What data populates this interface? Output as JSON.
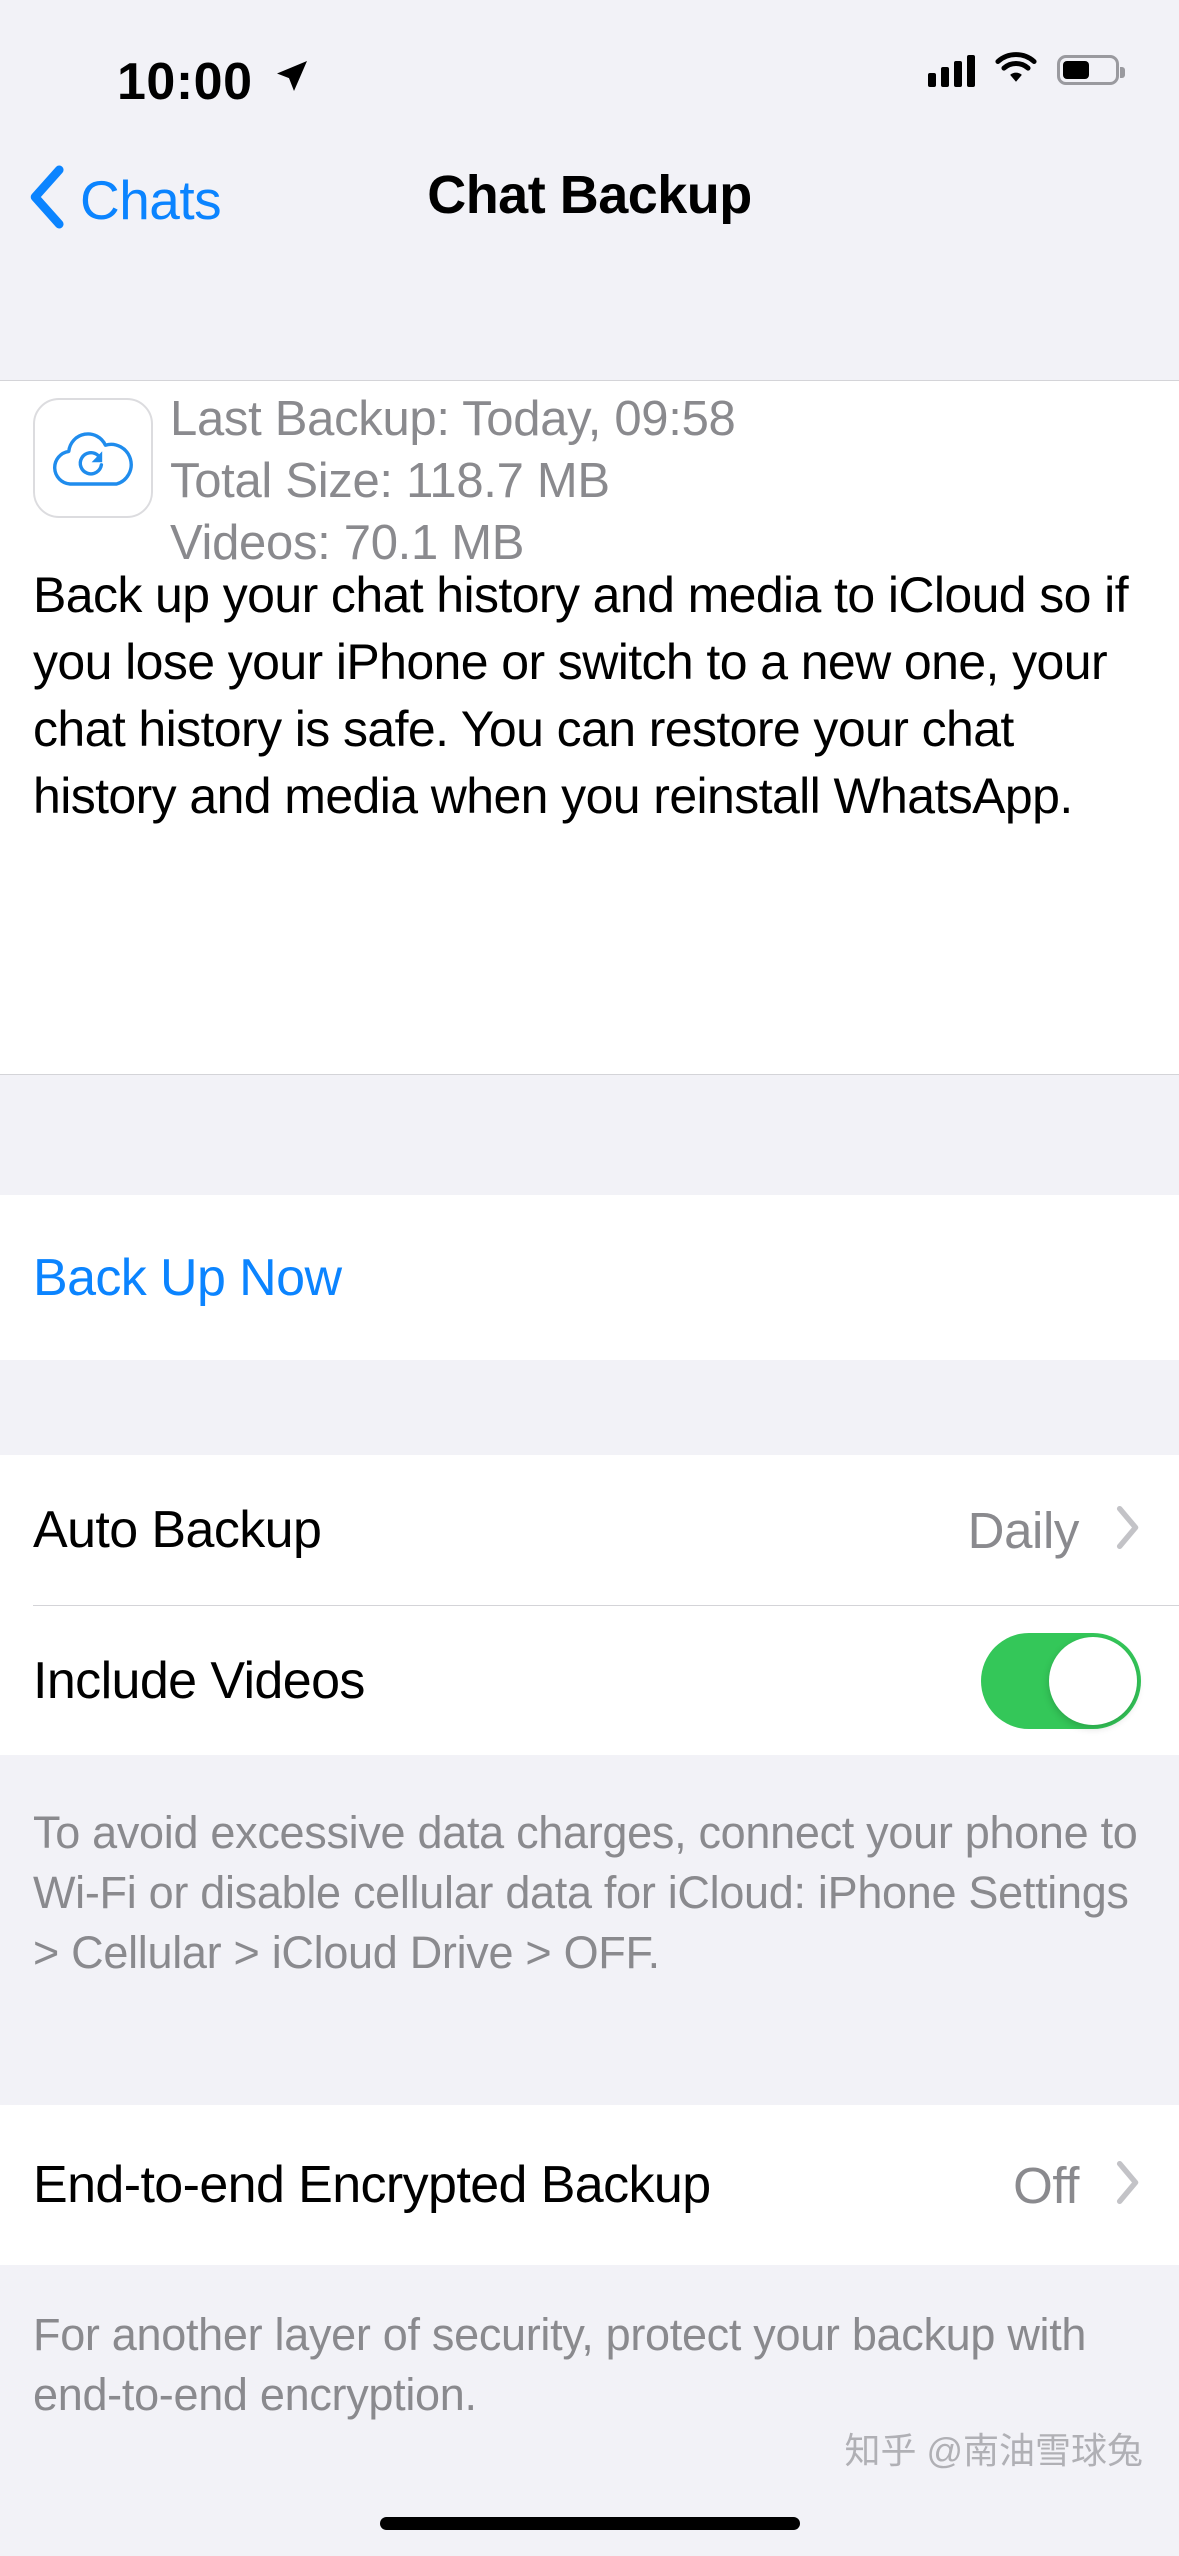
{
  "status_bar": {
    "time": "10:00",
    "location_icon": "location-arrow-icon",
    "signal_icon": "cellular-bars-icon",
    "wifi_icon": "wifi-icon",
    "battery_icon": "battery-icon",
    "battery_level_percent": 52
  },
  "nav": {
    "back_label": "Chats",
    "back_icon": "chevron-left-icon",
    "title": "Chat Backup"
  },
  "backup_info": {
    "icon": "cloud-sync-icon",
    "last_backup": "Last Backup: Today, 09:58",
    "total_size": "Total Size: 118.7 MB",
    "videos": "Videos: 70.1 MB",
    "description": "Back up your chat history and media to iCloud so if you lose your iPhone or switch to a new one, your chat history is safe. You can restore your chat history and media when you reinstall WhatsApp."
  },
  "actions": {
    "back_up_now": "Back Up Now"
  },
  "settings": {
    "auto_backup": {
      "label": "Auto Backup",
      "value": "Daily",
      "chevron_icon": "chevron-right-icon"
    },
    "include_videos": {
      "label": "Include Videos",
      "toggle_state": "on",
      "toggle_color": "#34c759"
    },
    "cellular_note": "To avoid excessive data charges, connect your phone to Wi-Fi or disable cellular data for iCloud: iPhone Settings > Cellular > iCloud Drive > OFF.",
    "e2e_backup": {
      "label": "End-to-end Encrypted Backup",
      "value": "Off",
      "chevron_icon": "chevron-right-icon"
    },
    "e2e_note": "For another layer of security, protect your backup with end-to-end encryption."
  },
  "watermark": "知乎 @南油雪球兔",
  "colors": {
    "accent_blue": "#0b84ff",
    "toggle_green": "#34c759",
    "secondary_text": "#8a8a8e",
    "group_background": "#f2f2f7"
  }
}
